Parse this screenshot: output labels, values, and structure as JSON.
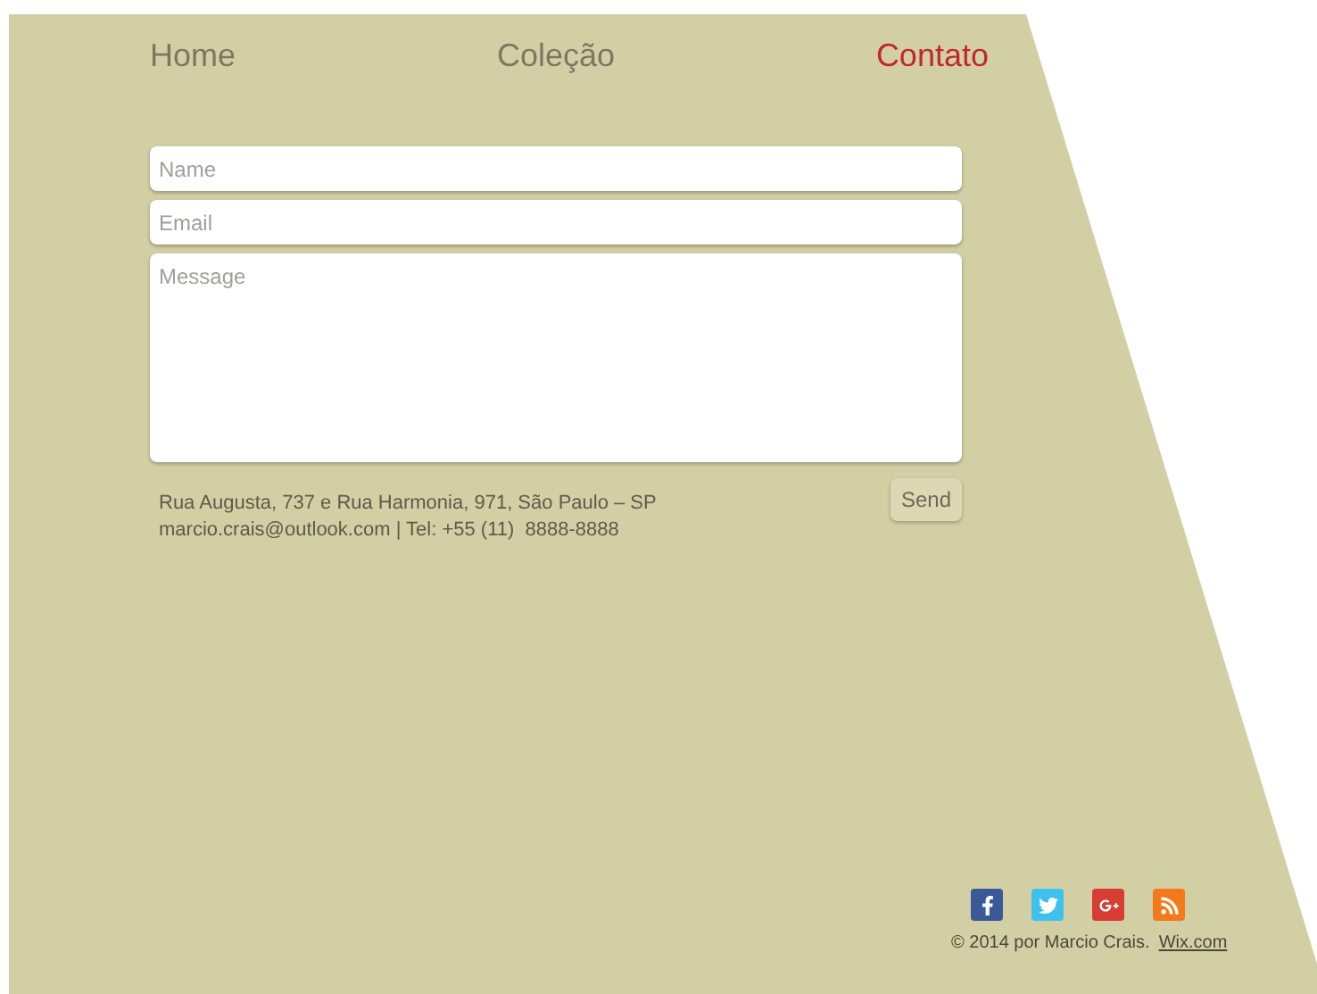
{
  "nav": [
    {
      "label": "Home",
      "selected": false
    },
    {
      "label": "Coleção",
      "selected": false
    },
    {
      "label": "Contato",
      "selected": true
    }
  ],
  "form": {
    "fields": [
      {
        "kind": "input",
        "placeholder": "Name"
      },
      {
        "kind": "input",
        "placeholder": "Email"
      },
      {
        "kind": "textarea",
        "placeholder": "Message"
      }
    ],
    "address": [
      "Rua Augusta, 737 e Rua Harmonia, 971, São Paulo – SP",
      "marcio.crais@outlook.com | Tel: +55 (11)  8888-8888"
    ],
    "submit": "Send"
  },
  "footer": {
    "social": [
      {
        "kind": "facebook",
        "color": "#3b5998"
      },
      {
        "kind": "twitter",
        "color": "#3fc1ee"
      },
      {
        "kind": "googleplus",
        "color": "#d73d32"
      },
      {
        "kind": "rss",
        "color": "#f27a1a"
      }
    ],
    "copyright": "© 2014 por Marcio Crais.",
    "link": "Wix.com"
  }
}
